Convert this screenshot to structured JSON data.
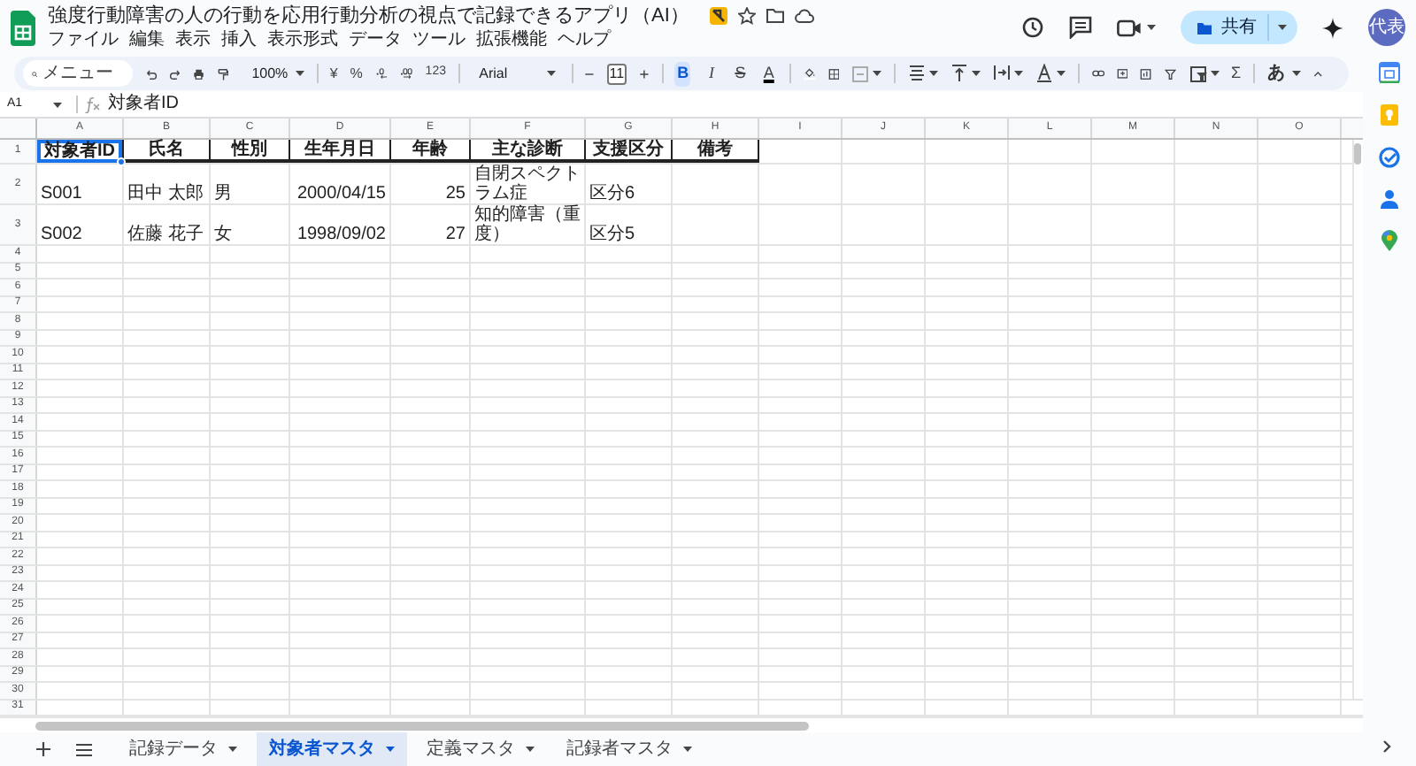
{
  "document": {
    "title": "強度行動障害の人の行動を応用行動分析の視点で記録できるアプリ（AI）",
    "starred": false
  },
  "menu": [
    "ファイル",
    "編集",
    "表示",
    "挿入",
    "表示形式",
    "データ",
    "ツール",
    "拡張機能",
    "ヘルプ"
  ],
  "header_actions": {
    "share_label": "共有",
    "avatar_label": "代表"
  },
  "toolbar": {
    "search_placeholder": "メニュー",
    "zoom": "100%",
    "currency": "¥",
    "percent": "%",
    "number_format": "123",
    "font": "Arial",
    "font_size": "11",
    "format_buttons": [
      {
        "kind": "bold",
        "label": "B",
        "selected": true
      },
      {
        "kind": "italic",
        "label": "I",
        "selected": false
      },
      {
        "kind": "strike",
        "label": "S",
        "selected": false
      },
      {
        "kind": "color",
        "label": "A",
        "selected": false
      }
    ],
    "functions": "Σ",
    "input_tools": "あ"
  },
  "formula_bar": {
    "cell_ref": "A1",
    "formula": "対象者ID"
  },
  "columns": [
    "A",
    "B",
    "C",
    "D",
    "E",
    "F",
    "G",
    "H",
    "I",
    "J",
    "K",
    "L",
    "M",
    "N",
    "O"
  ],
  "rows": [
    {
      "number": "1",
      "cells": [
        {
          "kind": "header",
          "text": "対象者ID",
          "selected": true
        },
        {
          "kind": "header",
          "text": "氏名",
          "selected": false
        },
        {
          "kind": "header",
          "text": "性別",
          "selected": false
        },
        {
          "kind": "header",
          "text": "生年月日",
          "selected": false
        },
        {
          "kind": "header",
          "text": "年齢",
          "selected": false
        },
        {
          "kind": "header",
          "text": "主な診断",
          "selected": false
        },
        {
          "kind": "header",
          "text": "支援区分",
          "selected": false
        },
        {
          "kind": "header",
          "text": "備考",
          "selected": false
        }
      ]
    },
    {
      "number": "2",
      "cells": [
        {
          "kind": "text",
          "text": "S001",
          "selected": false
        },
        {
          "kind": "text",
          "text": "田中 太郎",
          "selected": false
        },
        {
          "kind": "text",
          "text": "男",
          "selected": false
        },
        {
          "kind": "number",
          "text": "2000/04/15",
          "selected": false
        },
        {
          "kind": "number",
          "text": "25",
          "selected": false
        },
        {
          "kind": "text",
          "text": "自閉スペクトラム症",
          "selected": false
        },
        {
          "kind": "text",
          "text": "区分6",
          "selected": false
        }
      ]
    },
    {
      "number": "3",
      "cells": [
        {
          "kind": "text",
          "text": "S002",
          "selected": false
        },
        {
          "kind": "text",
          "text": "佐藤 花子",
          "selected": false
        },
        {
          "kind": "text",
          "text": "女",
          "selected": false
        },
        {
          "kind": "number",
          "text": "1998/09/02",
          "selected": false
        },
        {
          "kind": "number",
          "text": "27",
          "selected": false
        },
        {
          "kind": "text",
          "text": "知的障害（重度）",
          "selected": false
        },
        {
          "kind": "text",
          "text": "区分5",
          "selected": false
        }
      ]
    },
    {
      "number": "4"
    },
    {
      "number": "5"
    },
    {
      "number": "6"
    },
    {
      "number": "7"
    },
    {
      "number": "8"
    },
    {
      "number": "9"
    },
    {
      "number": "10"
    },
    {
      "number": "11"
    },
    {
      "number": "12"
    },
    {
      "number": "13"
    },
    {
      "number": "14"
    },
    {
      "number": "15"
    },
    {
      "number": "16"
    },
    {
      "number": "17"
    },
    {
      "number": "18"
    },
    {
      "number": "19"
    },
    {
      "number": "20"
    },
    {
      "number": "21"
    },
    {
      "number": "22"
    },
    {
      "number": "23"
    },
    {
      "number": "24"
    },
    {
      "number": "25"
    },
    {
      "number": "26"
    },
    {
      "number": "27"
    },
    {
      "number": "28"
    },
    {
      "number": "29"
    },
    {
      "number": "30"
    },
    {
      "number": "31"
    }
  ],
  "sheet_tabs": [
    {
      "label": "記録データ",
      "selected": false
    },
    {
      "label": "対象者マスタ",
      "selected": true
    },
    {
      "label": "定義マスタ",
      "selected": false
    },
    {
      "label": "記録者マスタ",
      "selected": false
    }
  ]
}
